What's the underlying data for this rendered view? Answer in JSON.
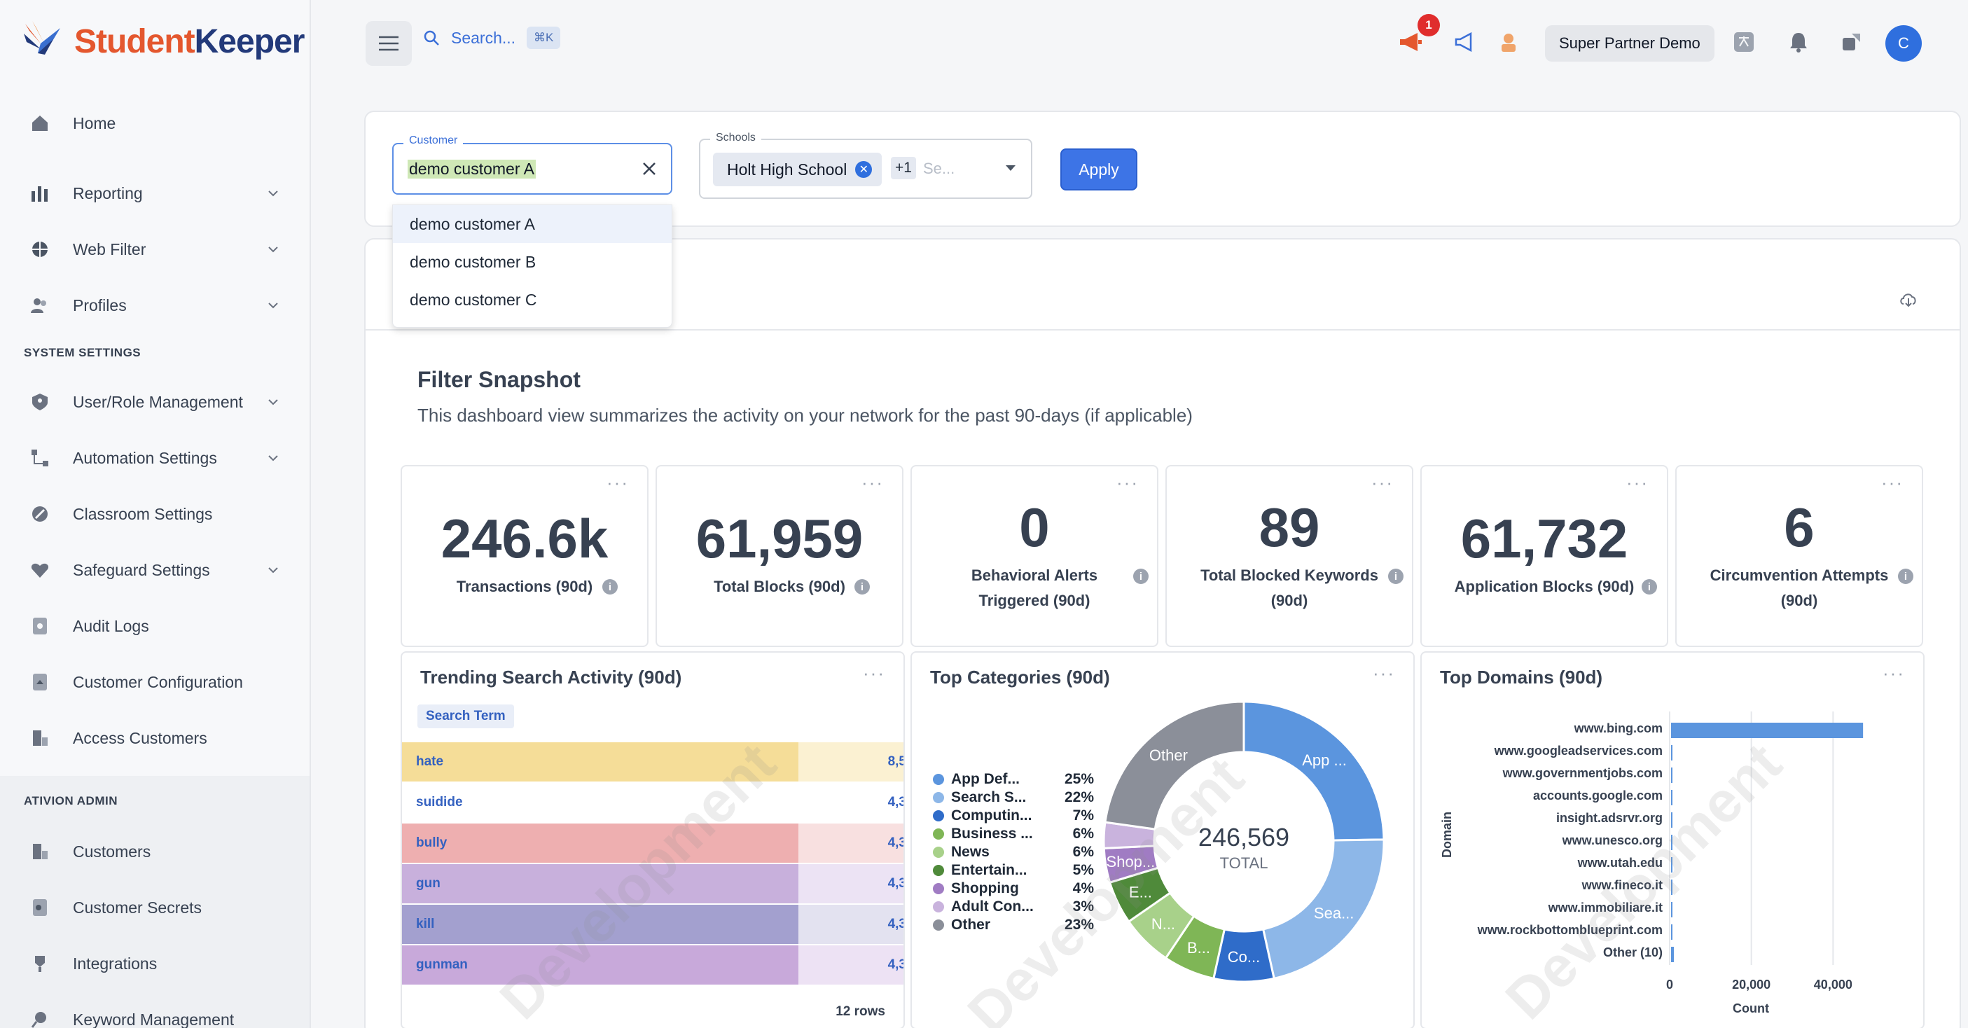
{
  "brand": {
    "part1": "Student",
    "part2": "Keeper"
  },
  "sidebar": {
    "items": [
      {
        "label": "Home",
        "icon": "home-icon"
      },
      {
        "label": "Reporting",
        "icon": "bar-chart-icon"
      },
      {
        "label": "Web Filter",
        "icon": "globe-icon"
      },
      {
        "label": "Profiles",
        "icon": "users-icon"
      }
    ],
    "section_system": "SYSTEM SETTINGS",
    "system_items": [
      {
        "label": "User/Role Management",
        "icon": "user-shield-icon"
      },
      {
        "label": "Automation Settings",
        "icon": "automation-icon"
      },
      {
        "label": "Classroom Settings",
        "icon": "classroom-icon"
      },
      {
        "label": "Safeguard Settings",
        "icon": "heart-icon"
      },
      {
        "label": "Audit Logs",
        "icon": "audit-icon"
      },
      {
        "label": "Customer Configuration",
        "icon": "config-icon"
      },
      {
        "label": "Access Customers",
        "icon": "access-icon"
      }
    ],
    "section_admin": "ATIVION ADMIN",
    "admin_items": [
      {
        "label": "Customers",
        "icon": "building-icon"
      },
      {
        "label": "Customer Secrets",
        "icon": "key-icon"
      },
      {
        "label": "Integrations",
        "icon": "integrations-icon"
      },
      {
        "label": "Keyword Management",
        "icon": "keyword-icon"
      }
    ]
  },
  "topbar": {
    "search_placeholder": "Search...",
    "shortcut": "⌘K",
    "notification_count": "1",
    "partner_label": "Super Partner Demo",
    "avatar_initial": "C"
  },
  "filters": {
    "customer_label": "Customer",
    "customer_value": "demo customer A",
    "customer_options": [
      "demo customer A",
      "demo customer B",
      "demo customer C"
    ],
    "schools_label": "Schools",
    "school_chip": "Holt High School",
    "school_more": "+1",
    "schools_placeholder": "Se...",
    "apply_label": "Apply"
  },
  "snapshot": {
    "title": "Filter Snapshot",
    "subtitle": "This dashboard view summarizes the activity on your network for the past 90-days (if applicable)",
    "watermark": "Development"
  },
  "kpis": [
    {
      "value": "246.6k",
      "label": "Transactions (90d)"
    },
    {
      "value": "61,959",
      "label": "Total Blocks (90d)"
    },
    {
      "value": "0",
      "label": "Behavioral Alerts Triggered (90d)"
    },
    {
      "value": "89",
      "label": "Total Blocked Keywords (90d)"
    },
    {
      "value": "61,732",
      "label": "Application Blocks (90d)"
    },
    {
      "value": "6",
      "label": "Circumvention Attempts (90d)"
    }
  ],
  "trending": {
    "title": "Trending Search Activity (90d)",
    "column": "Search Term",
    "rows": [
      {
        "term": "hate",
        "value": "8,5",
        "color": "#f5dd98",
        "light": "#fbf1d2"
      },
      {
        "term": "suidide",
        "value": "4,3",
        "color": "#ffffff",
        "light": "#ffffff"
      },
      {
        "term": "bully",
        "value": "4,3",
        "color": "#eeafb0",
        "light": "#f8e0e0"
      },
      {
        "term": "gun",
        "value": "4,3",
        "color": "#c8b0dc",
        "light": "#ece3f4"
      },
      {
        "term": "kill",
        "value": "4,3",
        "color": "#a3a0cf",
        "light": "#e3e2f0"
      },
      {
        "term": "gunman",
        "value": "4,3",
        "color": "#c8a9da",
        "light": "#ede2f4"
      }
    ],
    "row_count": "12 rows"
  },
  "categories": {
    "title": "Top Categories (90d)",
    "center_value": "246,569",
    "center_label": "TOTAL",
    "items": [
      {
        "name": "App Def...",
        "pct": "25%",
        "value": 25,
        "color": "#5b95de",
        "slice_label": "App ..."
      },
      {
        "name": "Search S...",
        "pct": "22%",
        "value": 22,
        "color": "#8db7e8",
        "slice_label": "Sea..."
      },
      {
        "name": "Computin...",
        "pct": "7%",
        "value": 7,
        "color": "#2f6cc9",
        "slice_label": "Co..."
      },
      {
        "name": "Business ...",
        "pct": "6%",
        "value": 6,
        "color": "#7fb656",
        "slice_label": "B..."
      },
      {
        "name": "News",
        "pct": "6%",
        "value": 6,
        "color": "#a8d18a",
        "slice_label": "N..."
      },
      {
        "name": "Entertain...",
        "pct": "5%",
        "value": 5,
        "color": "#4f8a3a",
        "slice_label": "E..."
      },
      {
        "name": "Shopping",
        "pct": "4%",
        "value": 4,
        "color": "#a07cc3",
        "slice_label": "Shop..."
      },
      {
        "name": "Adult Con...",
        "pct": "3%",
        "value": 3,
        "color": "#c9b3dd",
        "slice_label": ""
      },
      {
        "name": "Other",
        "pct": "23%",
        "value": 23,
        "color": "#8b8f99",
        "slice_label": "Other"
      }
    ]
  },
  "chart_data": {
    "type": "bar",
    "title": "Top Domains (90d)",
    "xlabel": "Count",
    "ylabel": "Domain",
    "categories": [
      "www.bing.com",
      "www.googleadservices.com",
      "www.governmentjobs.com",
      "accounts.google.com",
      "insight.adsrvr.org",
      "www.unesco.org",
      "www.utah.edu",
      "www.fineco.it",
      "www.immobiliare.it",
      "www.rockbottomblueprint.com",
      "Other (10)"
    ],
    "values": [
      47000,
      20,
      20,
      20,
      20,
      20,
      20,
      20,
      20,
      20,
      700
    ],
    "xlim": [
      0,
      60000
    ],
    "xticks": [
      "0",
      "20,000",
      "40,000"
    ],
    "bar_color": "#5b95de",
    "grid": true
  }
}
